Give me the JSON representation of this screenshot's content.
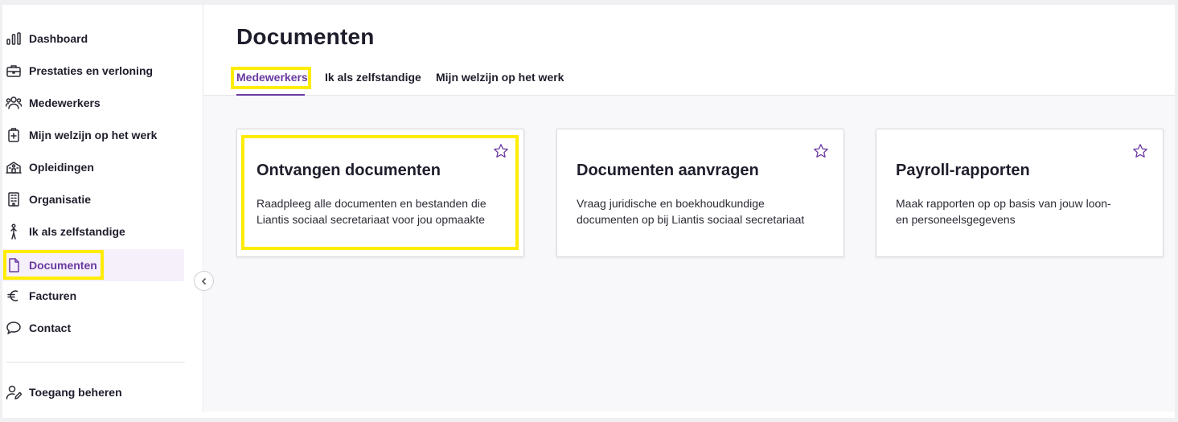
{
  "sidebar": {
    "items": [
      {
        "label": "Dashboard",
        "icon": "chart-bars-icon"
      },
      {
        "label": "Prestaties en verloning",
        "icon": "briefcase-icon"
      },
      {
        "label": "Medewerkers",
        "icon": "people-icon"
      },
      {
        "label": "Mijn welzijn op het werk",
        "icon": "medical-kit-icon"
      },
      {
        "label": "Opleidingen",
        "icon": "school-building-icon"
      },
      {
        "label": "Organisatie",
        "icon": "office-building-icon"
      },
      {
        "label": "Ik als zelfstandige",
        "icon": "walking-person-icon"
      },
      {
        "label": "Documenten",
        "icon": "document-icon"
      },
      {
        "label": "Facturen",
        "icon": "euro-icon"
      },
      {
        "label": "Contact",
        "icon": "chat-bubble-icon"
      }
    ],
    "active_index": 7,
    "bottom": {
      "label": "Toegang beheren",
      "icon": "user-edit-icon"
    }
  },
  "header": {
    "title": "Documenten",
    "tabs": [
      {
        "label": "Medewerkers"
      },
      {
        "label": "Ik als zelfstandige"
      },
      {
        "label": "Mijn welzijn op het werk"
      }
    ],
    "active_tab": 0
  },
  "cards": [
    {
      "title": "Ontvangen documenten",
      "description": "Raadpleeg alle documenten en bestanden die Liantis sociaal secretariaat voor jou opmaakte"
    },
    {
      "title": "Documenten aanvragen",
      "description": "Vraag juridische en boekhoudkundige documenten op bij Liantis sociaal secretariaat"
    },
    {
      "title": "Payroll-rapporten",
      "description": "Maak rapporten op op basis van jouw loon- en personeelsgegevens"
    }
  ],
  "colors": {
    "accent": "#6a3aa0",
    "highlight": "#ffec00",
    "active_bg": "#f6f0fb"
  }
}
